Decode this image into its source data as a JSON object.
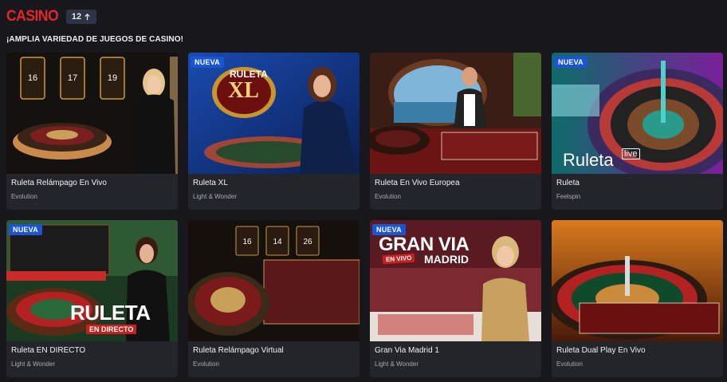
{
  "header": {
    "logo": "CASINO",
    "count": "12"
  },
  "section": {
    "title": "¡AMPLIA VARIEDAD DE JUEGOS DE CASINO!"
  },
  "games": [
    {
      "title": "Ruleta Relámpago En Vivo",
      "provider": "Evolution",
      "badge": ""
    },
    {
      "title": "Ruleta XL",
      "provider": "Light & Wonder",
      "badge": "NUEVA",
      "thumb_text": "RULETA",
      "thumb_text_2": "XL"
    },
    {
      "title": "Ruleta En Vivo Europea",
      "provider": "Evolution",
      "badge": ""
    },
    {
      "title": "Ruleta",
      "provider": "Feelspin",
      "badge": "NUEVA",
      "thumb_text": "Ruleta",
      "thumb_text_2": "live"
    },
    {
      "title": "Ruleta EN DIRECTO",
      "provider": "Light & Wonder",
      "badge": "NUEVA",
      "thumb_text": "RULETA",
      "thumb_text_2": "EN DIRECTO"
    },
    {
      "title": "Ruleta Relámpago Virtual",
      "provider": "Evolution",
      "badge": ""
    },
    {
      "title": "Gran Via Madrid 1",
      "provider": "Light & Wonder",
      "badge": "NUEVA",
      "thumb_text": "GRAN VIA",
      "thumb_text_2": "EN VIVO",
      "thumb_text_3": "MADRID"
    },
    {
      "title": "Ruleta Dual Play En Vivo",
      "provider": "Evolution",
      "badge": ""
    }
  ],
  "colors": {
    "background": "#18181c",
    "card": "#24252b",
    "logo_red": "#e3252b",
    "badge_blue": "#1a55d6"
  }
}
